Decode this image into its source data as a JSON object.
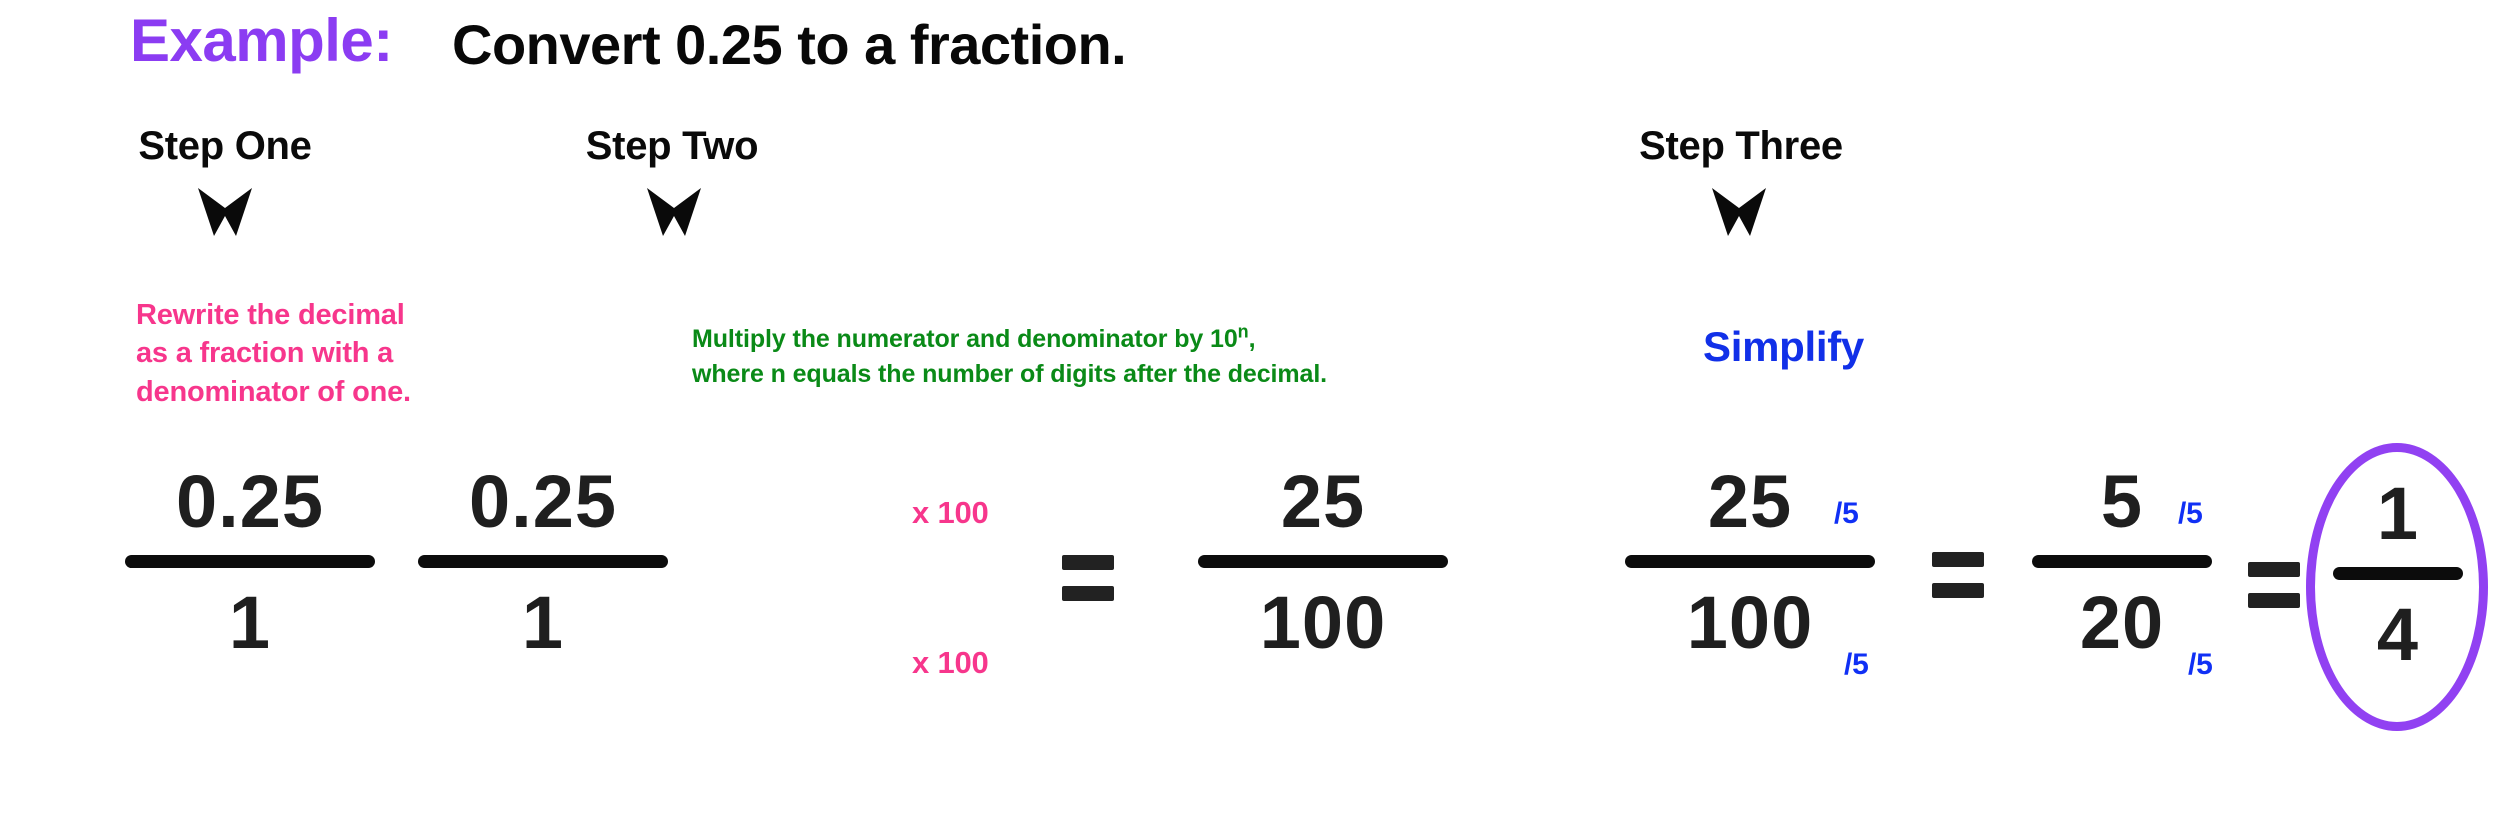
{
  "header": {
    "example_label": "Example:",
    "question": "Convert 0.25 to a fraction."
  },
  "steps": [
    {
      "title": "Step One",
      "arrow": "down-arrow-icon",
      "description": "Rewrite the decimal\nas a fraction with a\ndenominator of one.",
      "description_color": "#F7368C"
    },
    {
      "title": "Step Two",
      "arrow": "down-arrow-icon",
      "description_part1": "Multiply the numerator and denominator by 10",
      "description_superscript": "n",
      "description_part2": ",",
      "description_line2": "where n equals the number of digits after the decimal.",
      "description_color": "#0A8A17"
    },
    {
      "title": "Step Three",
      "arrow": "down-arrow-icon",
      "description": "Simplify",
      "description_color": "#1130E8"
    }
  ],
  "math": {
    "step1": {
      "fraction": {
        "numerator": "0.25",
        "denominator": "1"
      }
    },
    "step2": {
      "fraction_left": {
        "numerator": "0.25",
        "denominator": "1"
      },
      "op_numerator": "x 100",
      "op_denominator": "x 100",
      "equals": "=",
      "fraction_right": {
        "numerator": "25",
        "denominator": "100"
      }
    },
    "step3": {
      "fraction_left": {
        "numerator": "25",
        "denominator": "100"
      },
      "op_left_numerator": "/5",
      "op_left_denominator": "/5",
      "equals_1": "=",
      "fraction_mid": {
        "numerator": "5",
        "denominator": "20"
      },
      "op_mid_numerator": "/5",
      "op_mid_denominator": "/5",
      "equals_2": "=",
      "fraction_answer": {
        "numerator": "1",
        "denominator": "4"
      },
      "answer_highlight": "#9141F2"
    }
  },
  "colors": {
    "purple": "#8B3CF2",
    "pink": "#F7368C",
    "green": "#0A8A17",
    "blue": "#1130E8",
    "black": "#0c0c0c"
  }
}
